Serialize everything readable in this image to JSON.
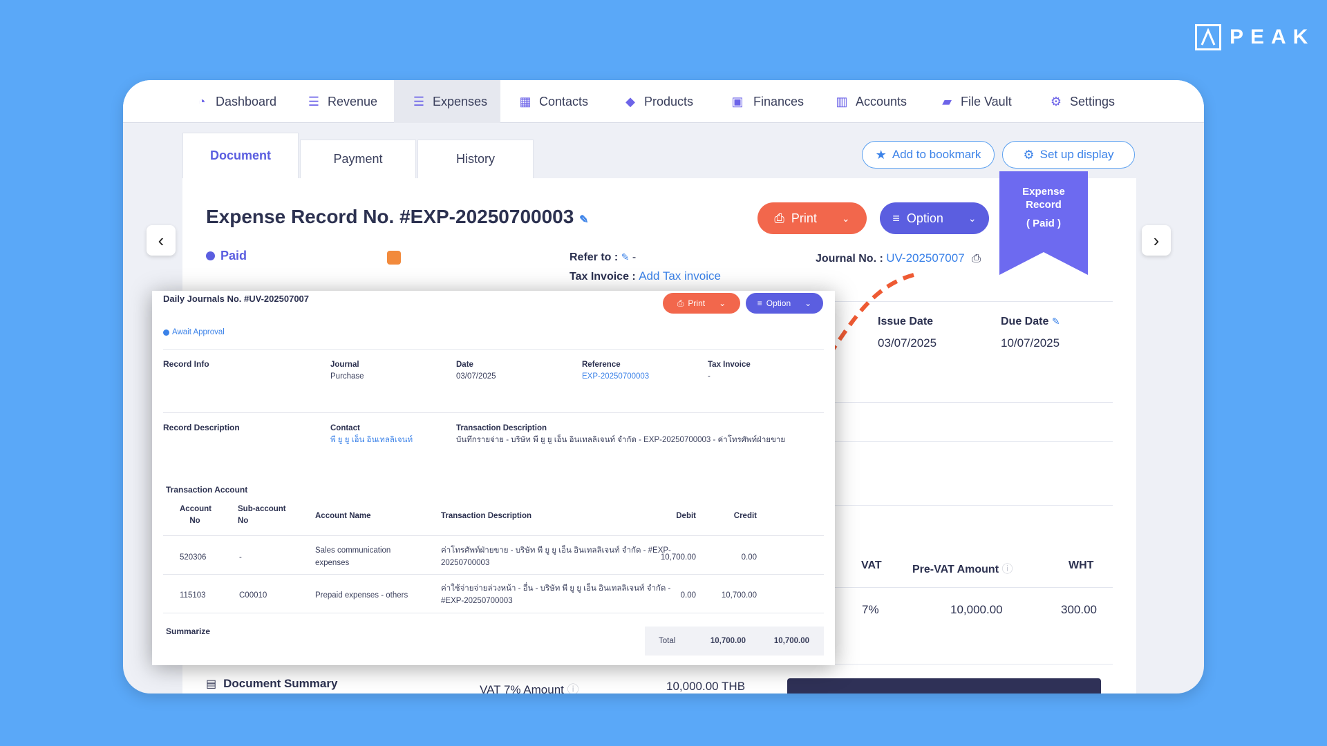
{
  "brand": {
    "logo_text": "PEAK"
  },
  "nav": {
    "items": [
      {
        "label": "Dashboard",
        "icon": "dashboard-icon"
      },
      {
        "label": "Revenue",
        "icon": "revenue-icon"
      },
      {
        "label": "Expenses",
        "icon": "expenses-icon"
      },
      {
        "label": "Contacts",
        "icon": "contacts-icon"
      },
      {
        "label": "Products",
        "icon": "products-icon"
      },
      {
        "label": "Finances",
        "icon": "finances-icon"
      },
      {
        "label": "Accounts",
        "icon": "accounts-icon"
      },
      {
        "label": "File Vault",
        "icon": "folder-icon"
      },
      {
        "label": "Settings",
        "icon": "gear-icon"
      }
    ],
    "active": "Expenses"
  },
  "tabs": [
    "Document",
    "Payment",
    "History"
  ],
  "toolbar": {
    "bookmark": "Add to bookmark",
    "display": "Set up display"
  },
  "document": {
    "title": "Expense Record No. #EXP-20250700003",
    "status": "Paid",
    "print": "Print",
    "option": "Option",
    "refer_label": "Refer to :",
    "refer_value": "-",
    "tax_label": "Tax Invoice :",
    "tax_value": "Add Tax invoice",
    "journal_label": "Journal No. :",
    "journal_value": "UV-202507007",
    "issue_label": "Issue Date",
    "issue_value": "03/07/2025",
    "due_label": "Due Date",
    "due_value": "10/07/2025",
    "ribbon_line1": "Expense",
    "ribbon_line2": "Record",
    "ribbon_line3": "( Paid )",
    "table_headers": {
      "vat": "VAT",
      "prevat": "Pre-VAT Amount",
      "wht": "WHT"
    },
    "table_row": {
      "vat": "7%",
      "prevat": "10,000.00",
      "wht": "300.00"
    },
    "summary_title": "Document Summary",
    "summary_label": "VAT 7% Amount",
    "summary_value": "10,000.00 THB"
  },
  "journal": {
    "title": "Daily Journals No. #UV-202507007",
    "status": "Await Approval",
    "print": "Print",
    "option": "Option",
    "record_info": "Record Info",
    "journal_label": "Journal",
    "journal_value": "Purchase",
    "date_label": "Date",
    "date_value": "03/07/2025",
    "ref_label": "Reference",
    "ref_value": "EXP-20250700003",
    "tax_label": "Tax Invoice",
    "tax_value": "-",
    "record_desc": "Record Description",
    "contact_label": "Contact",
    "contact_value": "พี ยู ยู เอ็น อินเทลลิเจนท์",
    "trans_label": "Transaction Description",
    "trans_value": "บันทึกรายจ่าย - บริษัท พี ยู ยู เอ็น อินเทลลิเจนท์ จำกัด - EXP-20250700003 - ค่าโทรศัพท์ฝ่ายขาย",
    "trans_account": "Transaction Account",
    "columns": {
      "acc_no_1": "Account",
      "acc_no_2": "No",
      "sub_1": "Sub-account",
      "sub_2": "No",
      "name": "Account Name",
      "desc": "Transaction Description",
      "debit": "Debit",
      "credit": "Credit"
    },
    "rows": [
      {
        "acc": "520306",
        "sub": "-",
        "name_1": "Sales communication",
        "name_2": "expenses",
        "desc_1": "ค่าโทรศัพท์ฝ่ายขาย - บริษัท พี ยู ยู เอ็น อินเทลลิเจนท์ จำกัด - #EXP-",
        "desc_2": "20250700003",
        "debit": "10,700.00",
        "credit": "0.00"
      },
      {
        "acc": "115103",
        "sub": "C00010",
        "name_1": "Prepaid expenses - others",
        "name_2": "",
        "desc_1": "ค่าใช้จ่ายจ่ายล่วงหน้า - อื่น - บริษัท พี ยู ยู เอ็น อินเทลลิเจนท์ จำกัด -",
        "desc_2": "#EXP-20250700003",
        "debit": "0.00",
        "credit": "10,700.00"
      }
    ],
    "summarize": "Summarize",
    "total_label": "Total",
    "total_debit": "10,700.00",
    "total_credit": "10,700.00"
  },
  "colors": {
    "accent": "#5b5ee0",
    "print": "#f2674c",
    "bg": "#5aa8f8",
    "link": "#3b82e8"
  }
}
